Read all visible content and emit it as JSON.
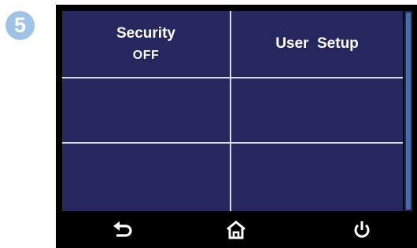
{
  "step": {
    "number": "5",
    "color": "#9ec3e6"
  },
  "screen": {
    "background": "#27275f",
    "cells": [
      {
        "title": "Security",
        "value": "OFF"
      },
      {
        "title": "User  Setup",
        "value": ""
      },
      {
        "title": "",
        "value": ""
      },
      {
        "title": "",
        "value": ""
      },
      {
        "title": "",
        "value": ""
      },
      {
        "title": "",
        "value": ""
      }
    ]
  },
  "nav": {
    "back_icon": "back-arrow-icon",
    "home_icon": "home-icon",
    "power_icon": "power-icon"
  }
}
